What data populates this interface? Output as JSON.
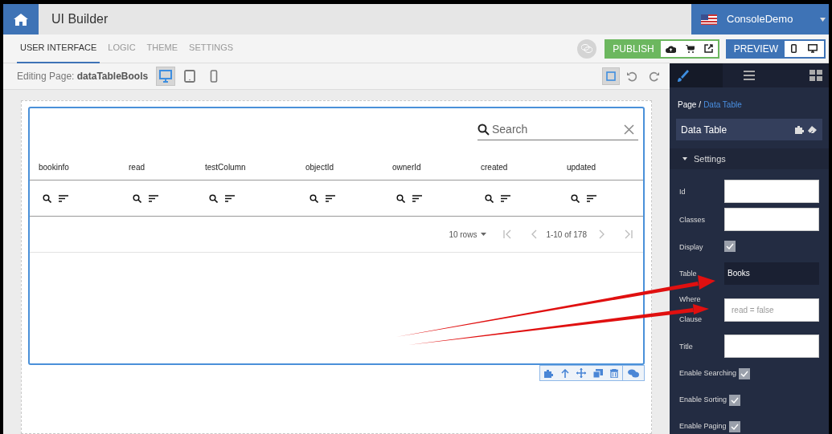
{
  "header": {
    "title": "UI Builder",
    "account": "ConsoleDemo"
  },
  "tabs": [
    {
      "label": "USER INTERFACE",
      "selected": true
    },
    {
      "label": "LOGIC",
      "selected": false
    },
    {
      "label": "THEME",
      "selected": false
    },
    {
      "label": "SETTINGS",
      "selected": false
    }
  ],
  "publish": {
    "label": "PUBLISH"
  },
  "preview": {
    "label": "PREVIEW"
  },
  "editing": {
    "label": "Editing Page:",
    "page": "dataTableBools"
  },
  "devices": [
    {
      "kind": "desktop",
      "selected": true
    },
    {
      "kind": "tablet",
      "selected": false
    },
    {
      "kind": "phone",
      "selected": false
    }
  ],
  "frame_toggle": {
    "selected": true
  },
  "panel": {
    "tabs": [
      {
        "kind": "brush",
        "selected": true
      },
      {
        "kind": "list",
        "selected": false
      },
      {
        "kind": "grid",
        "selected": false
      }
    ],
    "breadcrumb": [
      "Page",
      "Data Table"
    ],
    "breadcrumb_separator": "/",
    "component": "Data Table",
    "section": {
      "label": "Settings",
      "expanded": true
    },
    "fields": [
      {
        "kind": "text",
        "label": "Id"
      },
      {
        "kind": "text",
        "label": "Classes"
      },
      {
        "kind": "checkbox",
        "label": "Display",
        "checked": true
      },
      {
        "kind": "select",
        "label": "Table",
        "value": "Books"
      },
      {
        "kind": "text",
        "label": "Where Clause",
        "placeholder": "read = false"
      },
      {
        "kind": "text",
        "label": "Title"
      },
      {
        "kind": "inline-checkbox",
        "label": "Enable Searching",
        "checked": true
      },
      {
        "kind": "inline-checkbox",
        "label": "Enable Sorting",
        "checked": true
      },
      {
        "kind": "inline-checkbox",
        "label": "Enable Paging",
        "checked": true
      }
    ]
  },
  "table": {
    "search_placeholder": "Search",
    "columns": [
      "bookinfo",
      "read",
      "testColumn",
      "objectId",
      "ownerId",
      "created",
      "updated"
    ],
    "rows_per_page": "10 rows",
    "range": "1-10 of 178"
  }
}
